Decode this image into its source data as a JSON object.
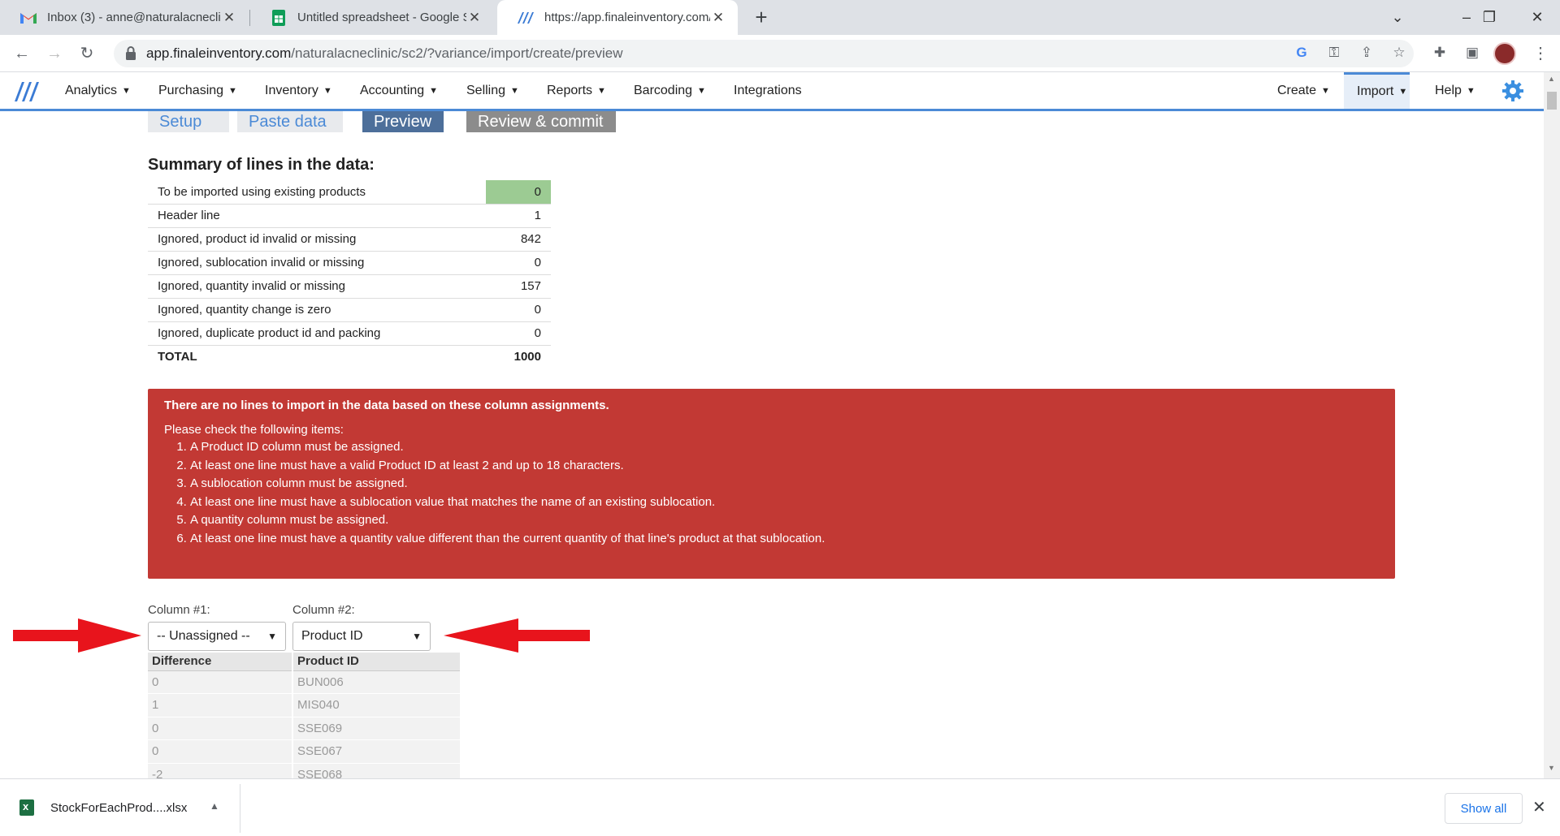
{
  "browser": {
    "tabs": [
      {
        "title": "Inbox (3) - anne@naturalacnecli",
        "icon": "gmail-icon"
      },
      {
        "title": "Untitled spreadsheet - Google Sh",
        "icon": "sheets-icon"
      },
      {
        "title": "https://app.finaleinventory.com/",
        "icon": "finale-icon"
      }
    ],
    "url_host": "app.finaleinventory.com",
    "url_path": "/naturalacneclinic/sc2/?variance/import/create/preview"
  },
  "nav": {
    "items": [
      "Analytics",
      "Purchasing",
      "Inventory",
      "Accounting",
      "Selling",
      "Reports",
      "Barcoding",
      "Integrations"
    ],
    "right_items": [
      "Create",
      "Import",
      "Help"
    ],
    "active": "Import"
  },
  "steps": [
    "Setup",
    "Paste data",
    "Preview",
    "Review & commit"
  ],
  "summary": {
    "title": "Summary of lines in the data:",
    "rows": [
      {
        "label": "To be imported using existing products",
        "value": "0"
      },
      {
        "label": "Header line",
        "value": "1"
      },
      {
        "label": "Ignored, product id invalid or missing",
        "value": "842"
      },
      {
        "label": "Ignored, sublocation invalid or missing",
        "value": "0"
      },
      {
        "label": "Ignored, quantity invalid or missing",
        "value": "157"
      },
      {
        "label": "Ignored, quantity change is zero",
        "value": "0"
      },
      {
        "label": "Ignored, duplicate product id and packing",
        "value": "0"
      }
    ],
    "total_label": "TOTAL",
    "total_value": "1000"
  },
  "error": {
    "heading": "There are no lines to import in the data based on these column assignments.",
    "lead": "Please check the following items:",
    "items": [
      "A Product ID column must be assigned.",
      "At least one line must have a valid Product ID at least 2 and up to 18 characters.",
      "A sublocation column must be assigned.",
      "At least one line must have a sublocation value that matches the name of an existing sublocation.",
      "A quantity column must be assigned.",
      "At least one line must have a quantity value different than the current quantity of that line's product at that sublocation."
    ]
  },
  "columns": [
    {
      "label": "Column #1:",
      "selected": "-- Unassigned --"
    },
    {
      "label": "Column #2:",
      "selected": "Product ID"
    }
  ],
  "preview": {
    "headers": [
      "Difference",
      "Product ID"
    ],
    "rows": [
      [
        "0",
        "BUN006"
      ],
      [
        "1",
        "MIS040"
      ],
      [
        "0",
        "SSE069"
      ],
      [
        "0",
        "SSE067"
      ],
      [
        "-2",
        "SSE068"
      ]
    ]
  },
  "downloads": {
    "file": "StockForEachProd....xlsx",
    "show_all": "Show all"
  },
  "colors": {
    "error_bg": "#c23934",
    "accent": "#4b8ad6",
    "highlight": "#9ccb93",
    "arrow": "#e8141c"
  }
}
